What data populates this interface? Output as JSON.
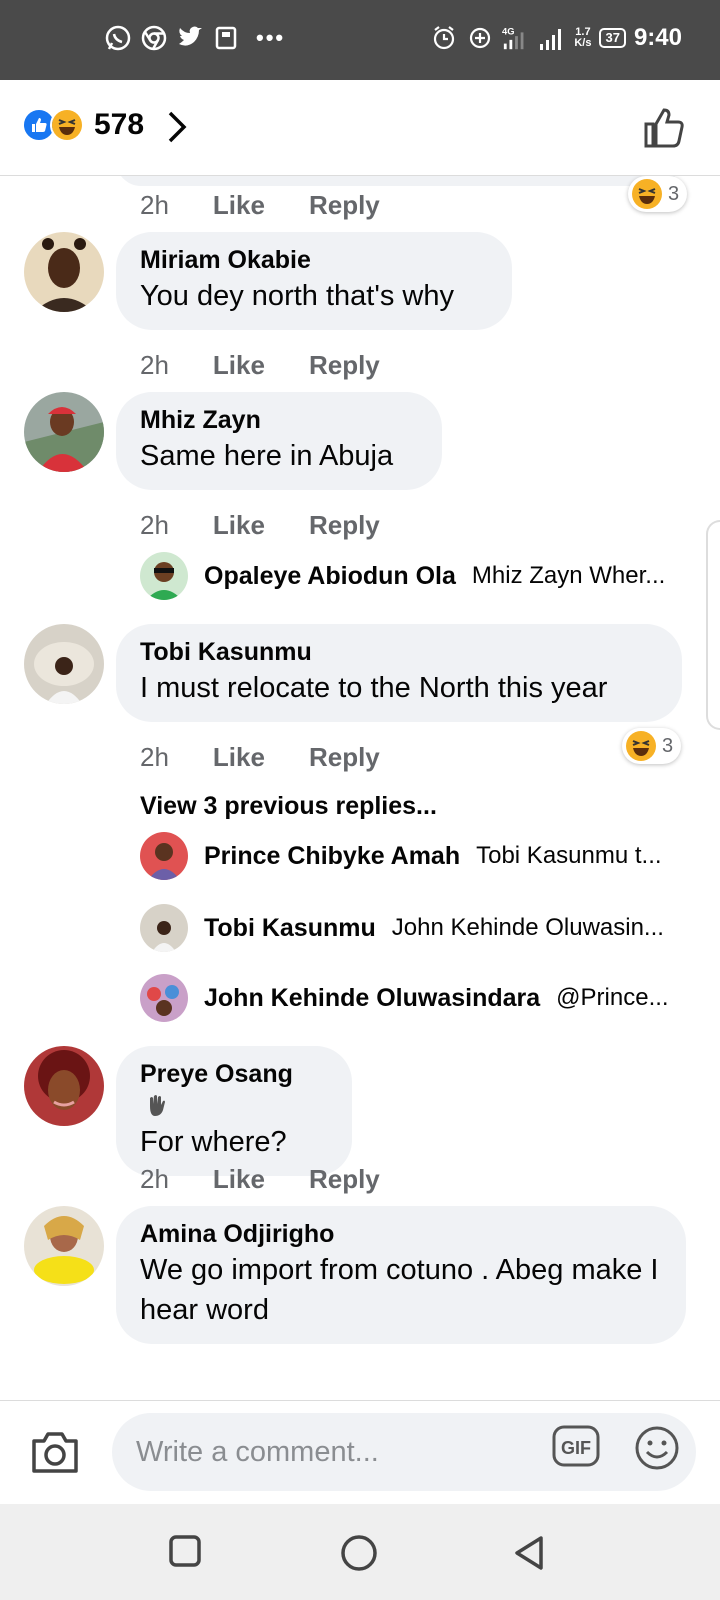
{
  "status_bar": {
    "time": "9:40",
    "network_speed": "1.7",
    "network_unit": "K/s",
    "battery": "37",
    "signal": "4G"
  },
  "header": {
    "reaction_count": "578"
  },
  "comments": [
    {
      "name": "Miriam Okabie",
      "text": "You dey north that's why",
      "time": "2h",
      "like": "Like",
      "reply": "Reply"
    },
    {
      "name": "Mhiz Zayn",
      "text": "Same here in Abuja",
      "time": "2h",
      "like": "Like",
      "reply": "Reply",
      "replies": [
        {
          "name": "Opaleye Abiodun Ola",
          "snippet": "Mhiz Zayn Wher..."
        }
      ]
    },
    {
      "name": "Tobi Kasunmu",
      "text": "I must relocate to the North this year",
      "time": "2h",
      "like": "Like",
      "reply": "Reply",
      "reaction_count": "3",
      "view_previous": "View 3 previous replies...",
      "replies": [
        {
          "name": "Prince Chibyke Amah",
          "snippet": "Tobi Kasunmu t..."
        },
        {
          "name": "Tobi Kasunmu",
          "snippet": "John Kehinde Oluwasin..."
        },
        {
          "name": "John Kehinde Oluwasindara",
          "snippet": "@Prince..."
        }
      ]
    },
    {
      "name": "Preye Osang",
      "text": "For where?",
      "time": "2h",
      "like": "Like",
      "reply": "Reply"
    },
    {
      "name": "Amina Odjirigho",
      "text": "We go import from cotuno . Abeg make I hear word"
    }
  ],
  "top_partial": {
    "time": "2h",
    "like": "Like",
    "reply": "Reply",
    "reaction_count": "3"
  },
  "composer": {
    "placeholder": "Write a comment...",
    "gif": "GIF"
  },
  "colors": {
    "brand": "#1877f2",
    "bubble": "#f0f2f5",
    "meta": "#65676b"
  }
}
